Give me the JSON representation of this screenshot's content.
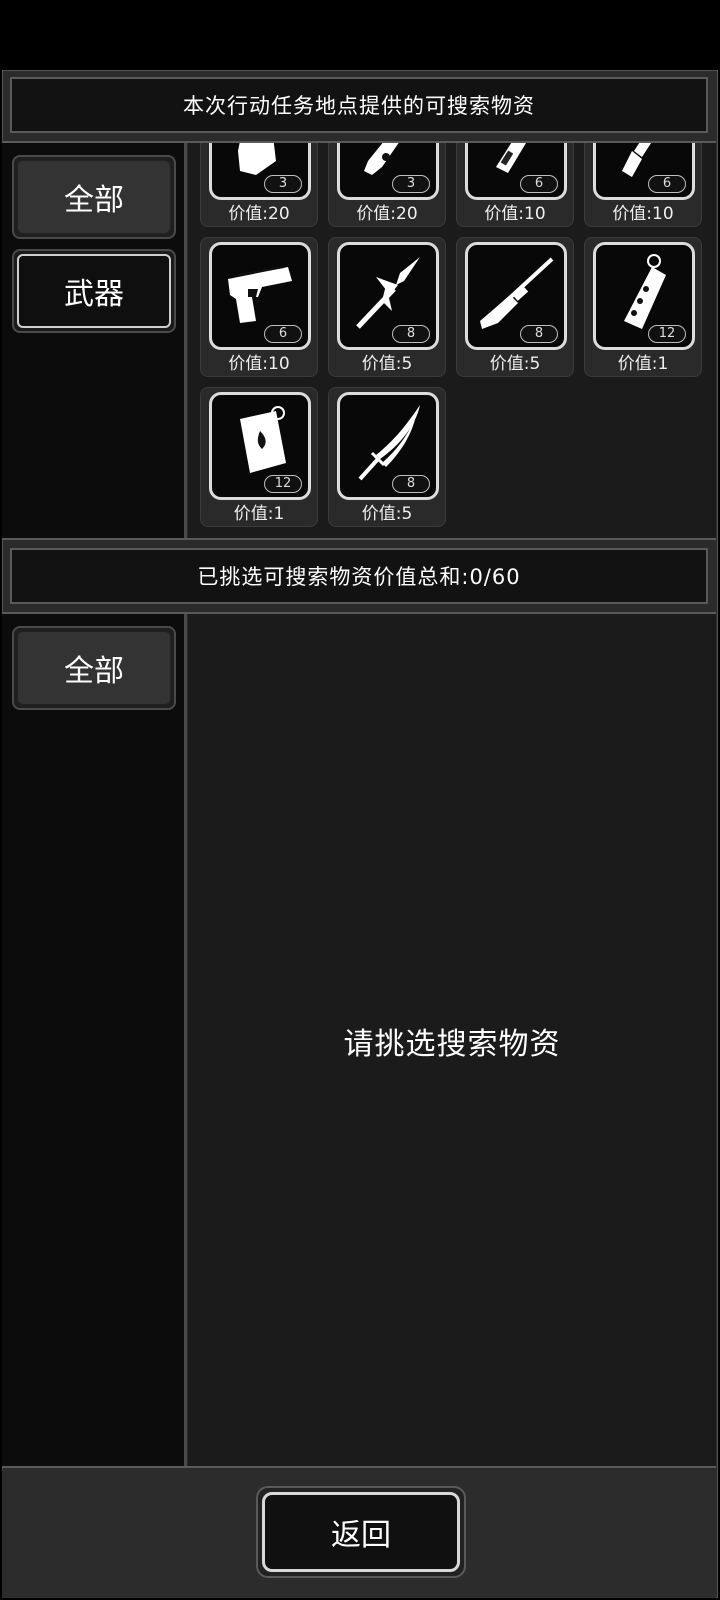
{
  "available": {
    "title": "本次行动任务地点提供的可搜索物资",
    "categories": [
      {
        "label": "全部",
        "active": true
      },
      {
        "label": "武器",
        "active": false
      }
    ],
    "items": [
      {
        "icon": "bandage-icon",
        "qty": "3",
        "price": "价值:20"
      },
      {
        "icon": "syringe-icon",
        "qty": "3",
        "price": "价值:20"
      },
      {
        "icon": "baton-icon",
        "qty": "6",
        "price": "价值:10"
      },
      {
        "icon": "knife-icon",
        "qty": "6",
        "price": "价值:10"
      },
      {
        "icon": "pistol-icon",
        "qty": "6",
        "price": "价值:10"
      },
      {
        "icon": "spear-icon",
        "qty": "8",
        "price": "价值:5"
      },
      {
        "icon": "shotgun-icon",
        "qty": "8",
        "price": "价值:5"
      },
      {
        "icon": "grenade-icon",
        "qty": "12",
        "price": "价值:1"
      },
      {
        "icon": "incendiary-icon",
        "qty": "12",
        "price": "价值:1"
      },
      {
        "icon": "katana-icon",
        "qty": "8",
        "price": "价值:5"
      }
    ]
  },
  "selected": {
    "title": "已挑选可搜索物资价值总和:0/60",
    "categories": [
      {
        "label": "全部",
        "active": true
      }
    ],
    "empty_message": "请挑选搜索物资"
  },
  "footer": {
    "back_label": "返回"
  }
}
